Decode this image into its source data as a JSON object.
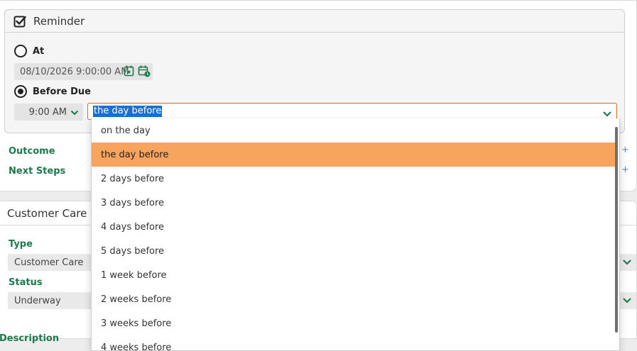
{
  "reminder": {
    "title": "Reminder",
    "at_label": "At",
    "date_value": "08/10/2026 9:00:00 AM",
    "before_due_label": "Before Due",
    "time_value": "9:00 AM",
    "before_value": "the day before"
  },
  "labels": {
    "outcome": "Outcome",
    "next_steps": "Next Steps",
    "plus": "+"
  },
  "customer_care": {
    "title": "Customer Care",
    "type_label": "Type",
    "type_value": "Customer Care",
    "status_label": "Status",
    "status_value": "Underway",
    "description_label": "Description"
  },
  "dropdown": {
    "options": [
      "on the day",
      "the day before",
      "2 days before",
      "3 days before",
      "4 days before",
      "5 days before",
      "1 week before",
      "2 weeks before",
      "3 weeks before",
      "4 weeks before"
    ],
    "highlighted_index": 1
  },
  "colors": {
    "label_green": "#1e7a4d",
    "highlight_orange": "#f8a35e",
    "focus_border": "#d96c1a",
    "selection_blue": "#1a6fcf"
  }
}
